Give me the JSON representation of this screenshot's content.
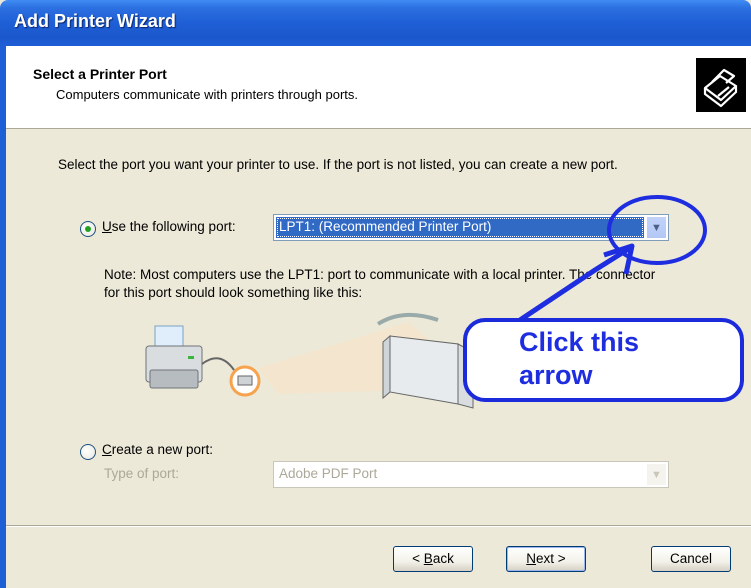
{
  "window": {
    "title": "Add Printer Wizard"
  },
  "header": {
    "title": "Select a Printer Port",
    "subtitle": "Computers communicate with printers through ports."
  },
  "intro": "Select the port you want your printer to use.  If the port is not listed, you can create a new port.",
  "use_port": {
    "label_prefix": "",
    "label_accel": "U",
    "label_rest": "se the following port:",
    "selected": "LPT1: (Recommended Printer Port)",
    "checked": true
  },
  "note": "Note: Most computers use the LPT1: port to communicate with a local printer. The connector for this port should look something like this:",
  "create_port": {
    "label_accel": "C",
    "label_rest": "reate a new port:",
    "type_label": "Type of port:",
    "type_value": "Adobe PDF Port",
    "checked": false
  },
  "buttons": {
    "back_prefix": "< ",
    "back_accel": "B",
    "back_rest": "ack",
    "next_accel": "N",
    "next_rest": "ext >",
    "cancel": "Cancel"
  },
  "annotation": {
    "line1": "Click this",
    "line2": "arrow",
    "color": "#1d2ddf"
  }
}
